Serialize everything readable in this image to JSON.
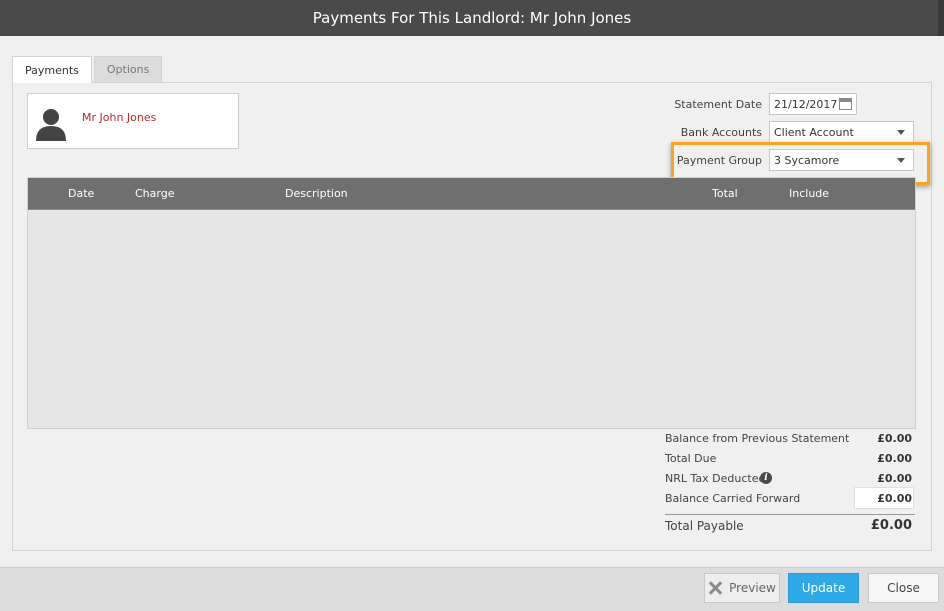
{
  "window": {
    "title": "Payments For This Landlord: Mr John Jones"
  },
  "tabs": [
    {
      "label": "Payments",
      "active": true
    },
    {
      "label": "Options",
      "active": false
    }
  ],
  "landlord": {
    "name": "Mr John Jones",
    "avatar_icon": "person-silhouette-icon"
  },
  "fields": {
    "statement_date": {
      "label": "Statement Date",
      "value": "21/12/2017",
      "icon": "calendar-icon"
    },
    "bank_accounts": {
      "label": "Bank Accounts",
      "value": "Client Account"
    },
    "payment_group": {
      "label": "Payment Group",
      "value": "3 Sycamore"
    }
  },
  "grid": {
    "columns": [
      "Date",
      "Charge",
      "Description",
      "Total",
      "Include"
    ],
    "rows": []
  },
  "summary": {
    "balance_prev_label": "Balance from Previous Statement",
    "balance_prev_value": "£0.00",
    "total_due_label": "Total Due",
    "total_due_value": "£0.00",
    "nrl_tax_label": "NRL Tax Deducted",
    "nrl_tax_value": "£0.00",
    "balance_cf_label": "Balance Carried Forward",
    "balance_cf_value": "£0.00",
    "total_payable_label": "Total Payable",
    "total_payable_value": "£0.00"
  },
  "buttons": {
    "preview": "Preview",
    "update": "Update",
    "close": "Close"
  },
  "colors": {
    "titlebar": "#4a4a4a",
    "accent_highlight": "#f5a623",
    "update_button": "#2fa8e6",
    "landlord_name": "#c0282d"
  }
}
